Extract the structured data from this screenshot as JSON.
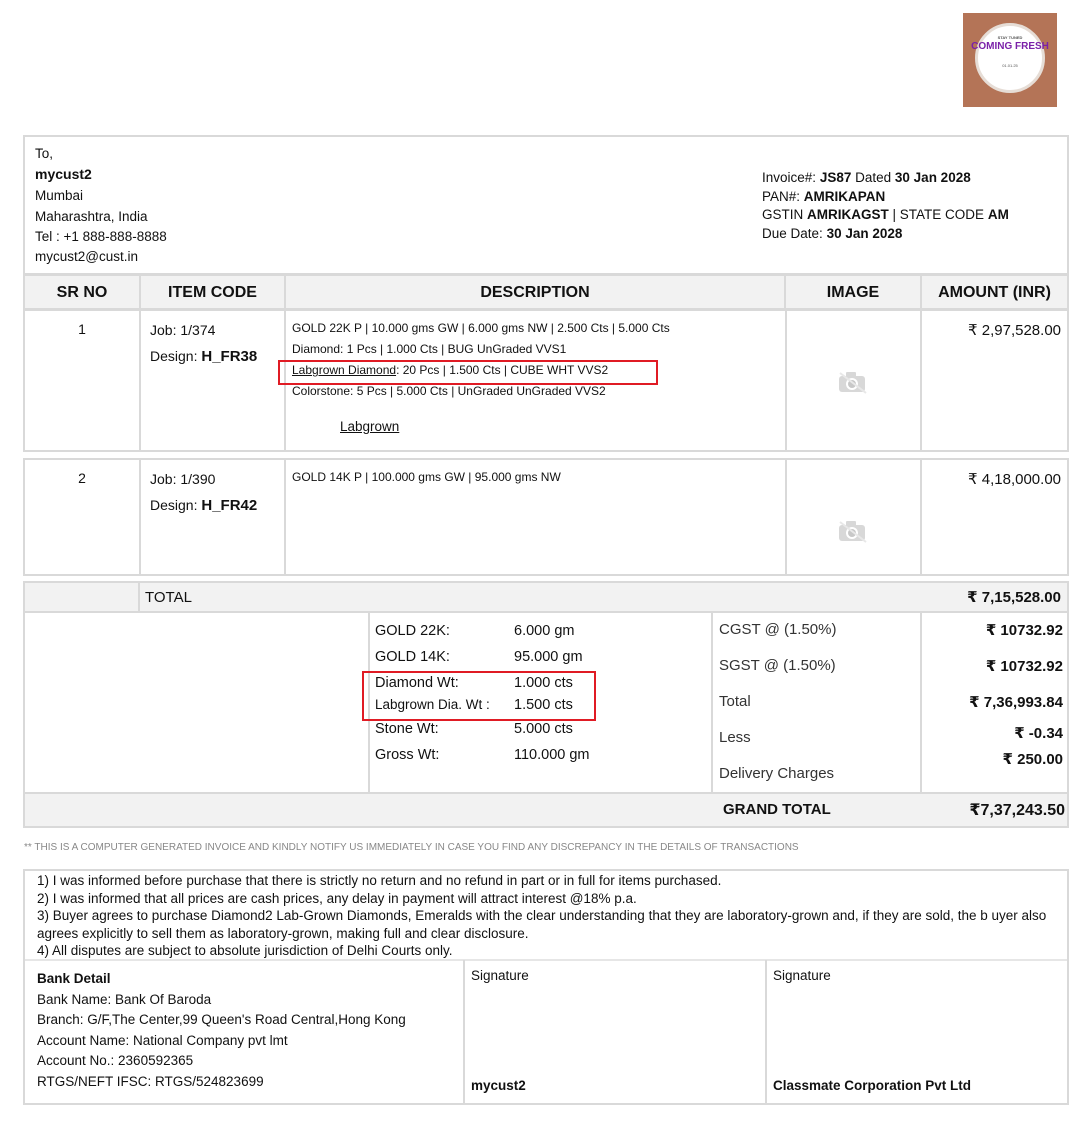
{
  "logo": {
    "top": "STAY TUNED",
    "main": "COMING FRESH",
    "date": "01.01.25"
  },
  "customer": {
    "to": "To,",
    "name": "mycust2",
    "city": "Mumbai",
    "state": "Maharashtra, India",
    "tel": "Tel : +1 888-888-8888",
    "email": "mycust2@cust.in"
  },
  "invoice": {
    "no_label": "Invoice#:",
    "no": "JS87",
    "dated_label": "Dated",
    "date": "30 Jan 2028",
    "pan_label": "PAN#:",
    "pan": "AMRIKAPAN",
    "gstin_label": "GSTIN",
    "gstin": "AMRIKAGST",
    "state_code_label": "| STATE CODE",
    "state_code": "AM",
    "due_label": "Due Date:",
    "due": "30 Jan 2028"
  },
  "table": {
    "headers": [
      "SR NO",
      "ITEM CODE",
      "DESCRIPTION",
      "IMAGE",
      "AMOUNT (INR)"
    ],
    "rows": [
      {
        "sr": "1",
        "job": "Job: 1/374",
        "design_label": "Design:",
        "design": "H_FR38",
        "lines": [
          "GOLD 22K P | 10.000 gms GW | 6.000 gms NW | 2.500 Cts | 5.000 Cts",
          "Diamond: 1 Pcs | 1.000 Cts | BUG UnGraded VVS1",
          "Labgrown Diamond",
          ": 20 Pcs | 1.500 Cts | CUBE WHT VVS2",
          "Colorstone: 5 Pcs | 5.000 Cts | UnGraded UnGraded VVS2"
        ],
        "link": "Labgrown",
        "amount": "₹ 2,97,528.00"
      },
      {
        "sr": "2",
        "job": "Job: 1/390",
        "design_label": "Design:",
        "design": "H_FR42",
        "lines": [
          "GOLD 14K P | 100.000 gms GW | 95.000 gms NW"
        ],
        "amount": "₹ 4,18,000.00"
      }
    ]
  },
  "total": {
    "label": "TOTAL",
    "value": "₹ 7,15,528.00"
  },
  "weights": [
    {
      "label": "GOLD 22K:",
      "value": "6.000 gm"
    },
    {
      "label": "GOLD 14K:",
      "value": "95.000 gm"
    },
    {
      "label": "Diamond Wt:",
      "value": "1.000 cts"
    },
    {
      "label": "Labgrown Dia. Wt :",
      "value": "1.500 cts"
    },
    {
      "label": "Stone Wt:",
      "value": "5.000 cts"
    },
    {
      "label": "Gross Wt:",
      "value": "110.000 gm"
    }
  ],
  "taxes": [
    {
      "label": "CGST @ (1.50%)",
      "value": "₹ 10732.92"
    },
    {
      "label": "SGST @ (1.50%)",
      "value": "₹ 10732.92"
    },
    {
      "label": "Total",
      "value": "₹ 7,36,993.84"
    },
    {
      "label": "Less",
      "value": "₹ -0.34"
    },
    {
      "label": "Delivery Charges",
      "value": "₹ 250.00"
    }
  ],
  "grand_total": {
    "label": "GRAND TOTAL",
    "value": "₹7,37,243.50"
  },
  "note": "** THIS IS A COMPUTER GENERATED INVOICE AND KINDLY NOTIFY US IMMEDIATELY IN CASE YOU FIND ANY DISCREPANCY IN THE DETAILS OF TRANSACTIONS",
  "terms": [
    "1) I was informed before purchase that there is strictly no return and no refund in part or in full for items purchased.",
    "2) I was informed that all prices are cash prices, any delay in payment will attract interest @18% p.a.",
    "3) Buyer agrees to purchase Diamond2 Lab-Grown Diamonds, Emeralds with the clear understanding that they are laboratory-grown and, if they are sold, the b uyer also agrees explicitly to sell them as laboratory-grown, making full and clear disclosure.",
    "4) All disputes are subject to absolute jurisdiction of Delhi Courts only."
  ],
  "bank": {
    "title": "Bank Detail",
    "name": "Bank Name: Bank Of Baroda",
    "branch": "Branch: G/F,The Center,99 Queen's Road Central,Hong Kong",
    "account_name": "Account Name: National Company pvt lmt",
    "account_no": "Account No.: 2360592365",
    "ifsc": "RTGS/NEFT IFSC: RTGS/524823699"
  },
  "signatures": [
    {
      "heading": "Signature",
      "name": "mycust2"
    },
    {
      "heading": "Signature",
      "name": "Classmate Corporation Pvt Ltd"
    }
  ]
}
